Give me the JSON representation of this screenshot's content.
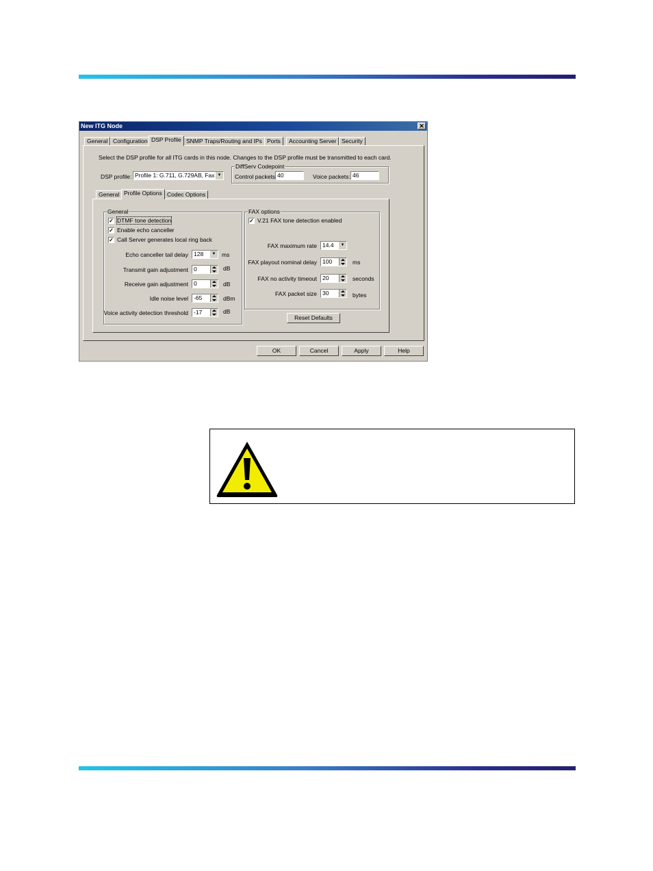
{
  "dialog": {
    "title": "New ITG Node",
    "close_symbol": "✕",
    "tabs": [
      "General",
      "Configuration",
      "DSP Profile",
      "SNMP Traps/Routing and IPs",
      "Ports",
      "Accounting Server",
      "Security"
    ],
    "instruction": "Select the DSP profile for all ITG cards in this node. Changes to the DSP profile must be transmitted to each card.",
    "dsp_profile_label": "DSP profile:",
    "dsp_profile_value": "Profile 1: G.711, G.729AB, Fax",
    "diffserv": {
      "title": "DiffServ Codepoint",
      "control_label": "Control packets:",
      "control_value": "40",
      "voice_label": "Voice packets:",
      "voice_value": "46"
    },
    "subtabs": [
      "General",
      "Profile Options",
      "Codec Options"
    ],
    "general_group": {
      "title": "General",
      "checks": [
        {
          "label": "DTMF tone detection",
          "checked": true
        },
        {
          "label": "Enable echo canceller",
          "checked": true
        },
        {
          "label": "Call Server generates local ring back",
          "checked": true
        }
      ],
      "fields": [
        {
          "label": "Echo canceller tail delay",
          "value": "128",
          "unit": "ms",
          "kind": "dropdown"
        },
        {
          "label": "Transmit gain adjustment",
          "value": "0",
          "unit": "dB",
          "kind": "spin"
        },
        {
          "label": "Receive gain adjustment",
          "value": "0",
          "unit": "dB",
          "kind": "spin"
        },
        {
          "label": "Idle noise level",
          "value": "-65",
          "unit": "dBm",
          "kind": "spin"
        },
        {
          "label": "Voice activity detection threshold",
          "value": "-17",
          "unit": "dB",
          "kind": "spin"
        }
      ]
    },
    "fax_group": {
      "title": "FAX options",
      "check": {
        "label": "V.21 FAX tone detection enabled",
        "checked": true
      },
      "fields": [
        {
          "label": "FAX maximum rate",
          "value": "14.4",
          "unit": "",
          "kind": "dropdown"
        },
        {
          "label": "FAX playout nominal delay",
          "value": "100",
          "unit": "ms",
          "kind": "spin"
        },
        {
          "label": "FAX no activity timeout",
          "value": "20",
          "unit": "seconds",
          "kind": "spin"
        },
        {
          "label": "FAX packet size",
          "value": "30",
          "unit": "bytes",
          "kind": "spin"
        }
      ]
    },
    "reset_label": "Reset Defaults",
    "buttons": {
      "ok": "OK",
      "cancel": "Cancel",
      "apply": "Apply",
      "help": "Help"
    },
    "check_mark": "✓",
    "dropdown_arrow": "▼"
  },
  "caution_icon": "warning-triangle"
}
